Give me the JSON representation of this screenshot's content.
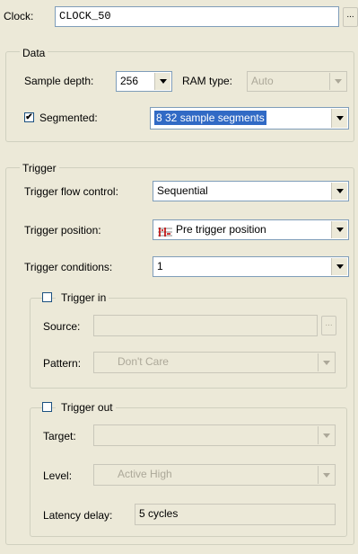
{
  "clock": {
    "label": "Clock:",
    "value": "CLOCK_50",
    "browse_label": "..."
  },
  "data_group": {
    "title": "Data",
    "sample_depth_label": "Sample depth:",
    "sample_depth_value": "256",
    "ram_type_label": "RAM type:",
    "ram_type_value": "Auto",
    "segmented_label": "Segmented:",
    "segmented_checked": "✔",
    "segmented_value": "8  32 sample segments"
  },
  "trigger_group": {
    "title": "Trigger",
    "flow_control_label": "Trigger flow control:",
    "flow_control_value": "Sequential",
    "position_label": "Trigger position:",
    "position_value": "Pre trigger position",
    "conditions_label": "Trigger conditions:",
    "conditions_value": "1"
  },
  "trigger_in": {
    "title": "Trigger in",
    "source_label": "Source:",
    "source_value": "",
    "browse_label": "...",
    "pattern_label": "Pattern:",
    "pattern_value": "Don't Care"
  },
  "trigger_out": {
    "title": "Trigger out",
    "target_label": "Target:",
    "target_value": "",
    "level_label": "Level:",
    "level_value": "Active High",
    "latency_label": "Latency delay:",
    "latency_value": "5 cycles"
  }
}
